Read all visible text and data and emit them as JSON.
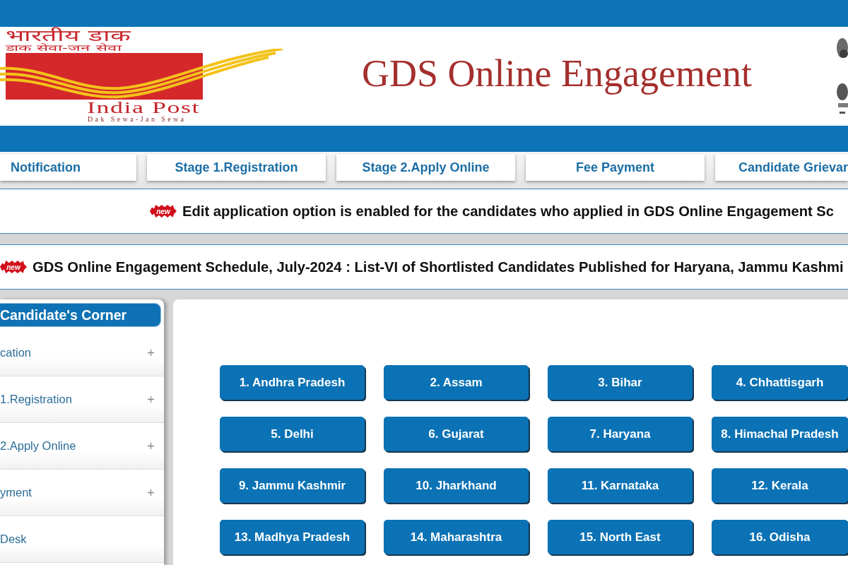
{
  "header": {
    "logo": {
      "hindi_name": "भारतीय डाक",
      "hindi_tagline": "डाक सेवा-जन सेवा",
      "name": "India Post",
      "tagline": "Dak Sewa-Jan Sewa"
    },
    "title": "GDS Online Engagement"
  },
  "nav_tabs": [
    {
      "label": "Notification"
    },
    {
      "label": "Stage 1.Registration"
    },
    {
      "label": "Stage 2.Apply Online"
    },
    {
      "label": "Fee Payment"
    },
    {
      "label": "Candidate Grievar"
    }
  ],
  "announcements": [
    {
      "badge": "new",
      "text": "Edit application option is enabled for the candidates who applied in GDS Online Engagement Sc"
    },
    {
      "badge": "new",
      "text": "GDS Online Engagement Schedule, July-2024 : List-VI of Shortlisted Candidates Published for Haryana, Jammu Kashmi"
    }
  ],
  "sidebar": {
    "title": "Candidate's Corner",
    "items": [
      {
        "label": "cation",
        "expandable": true
      },
      {
        "label": "1.Registration",
        "expandable": true
      },
      {
        "label": "2.Apply Online",
        "expandable": true
      },
      {
        "label": "yment",
        "expandable": true
      },
      {
        "label": "Desk",
        "expandable": false
      }
    ]
  },
  "state_buttons": [
    "1. Andhra Pradesh",
    "2. Assam",
    "3. Bihar",
    "4. Chhattisgarh",
    "5. Delhi",
    "6. Gujarat",
    "7. Haryana",
    "8. Himachal Pradesh",
    "9. Jammu Kashmir",
    "10. Jharkhand",
    "11. Karnataka",
    "12. Kerala",
    "13. Madhya Pradesh",
    "14. Maharashtra",
    "15. North East",
    "16. Odisha"
  ]
}
